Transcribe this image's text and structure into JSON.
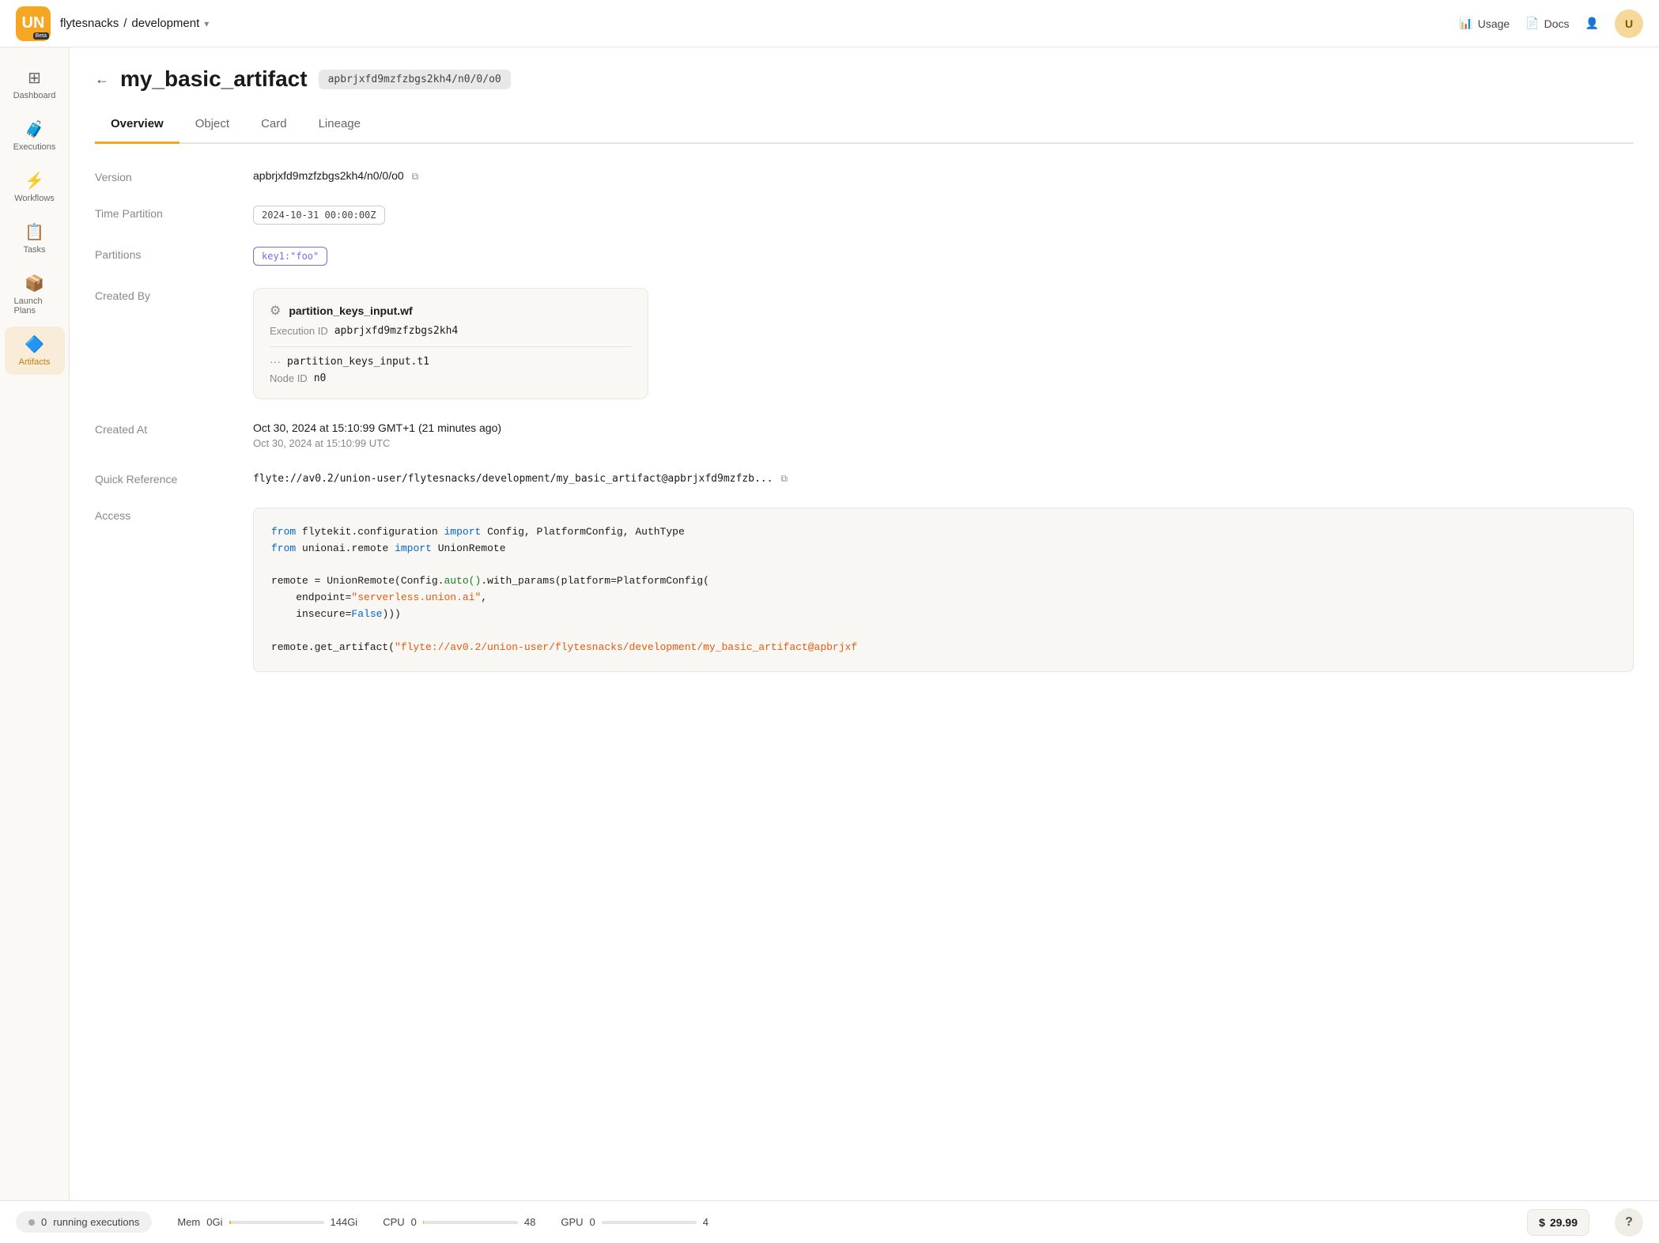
{
  "topnav": {
    "logo_text": "UN",
    "logo_beta": "Beta",
    "project": "flytesnacks",
    "env": "development",
    "usage_label": "Usage",
    "docs_label": "Docs",
    "user_initial": "U"
  },
  "sidebar": {
    "items": [
      {
        "id": "dashboard",
        "label": "Dashboard",
        "icon": "⊞"
      },
      {
        "id": "executions",
        "label": "Executions",
        "icon": "🧳"
      },
      {
        "id": "workflows",
        "label": "Workflows",
        "icon": "⚡"
      },
      {
        "id": "tasks",
        "label": "Tasks",
        "icon": "📋"
      },
      {
        "id": "launch-plans",
        "label": "Launch Plans",
        "icon": "📦"
      },
      {
        "id": "artifacts",
        "label": "Artifacts",
        "icon": "🔷",
        "active": true
      }
    ]
  },
  "page": {
    "back_arrow": "←",
    "title": "my_basic_artifact",
    "version_badge": "apbrjxfd9mzfzbgs2kh4/n0/0/o0"
  },
  "tabs": [
    {
      "id": "overview",
      "label": "Overview",
      "active": true
    },
    {
      "id": "object",
      "label": "Object"
    },
    {
      "id": "card",
      "label": "Card"
    },
    {
      "id": "lineage",
      "label": "Lineage"
    }
  ],
  "overview": {
    "version": {
      "label": "Version",
      "value": "apbrjxfd9mzfzbgs2kh4/n0/0/o0"
    },
    "time_partition": {
      "label": "Time Partition",
      "value": "2024-10-31 00:00:00Z"
    },
    "partitions": {
      "label": "Partitions",
      "value": "key1:\"foo\""
    },
    "created_by": {
      "label": "Created By",
      "workflow_name": "partition_keys_input.wf",
      "execution_id_label": "Execution ID",
      "execution_id": "apbrjxfd9mzfzbgs2kh4",
      "node_name": "partition_keys_input.t1",
      "node_id_label": "Node ID",
      "node_id": "n0"
    },
    "created_at": {
      "label": "Created At",
      "primary": "Oct 30, 2024 at 15:10:99 GMT+1 (21 minutes ago)",
      "secondary": "Oct 30, 2024 at 15:10:99 UTC"
    },
    "quick_reference": {
      "label": "Quick Reference",
      "value": "flyte://av0.2/union-user/flytesnacks/development/my_basic_artifact@apbrjxfd9mzfzb..."
    },
    "access": {
      "label": "Access",
      "code": {
        "line1_from": "from",
        "line1_pkg1": "flytekit.configuration",
        "line1_import": "import",
        "line1_items": "Config, PlatformConfig, AuthType",
        "line2_from": "from",
        "line2_pkg2": "unionai.remote",
        "line2_import": "import",
        "line2_item": "UnionRemote",
        "line3": "",
        "line4_pre": "remote = UnionRemote(Config.",
        "line4_method": "auto()",
        "line4_post": ".with_params(platform=PlatformConfig(",
        "line5_pre": "    endpoint=",
        "line5_val": "\"serverless.union.ai\"",
        "line5_post": ",",
        "line6_pre": "    insecure=",
        "line6_val": "False",
        "line6_post": ")))",
        "line7": "",
        "line8": "remote.get_artifact(\"flyte://av0.2/union-user/flytesnacks/development/my_basic_artifact@apbrjxf"
      }
    }
  },
  "status_bar": {
    "running_count": "0",
    "running_label": "running executions",
    "mem_label": "Mem",
    "mem_used": "0Gi",
    "mem_total": "144Gi",
    "mem_pct": 2,
    "cpu_label": "CPU",
    "cpu_used": "0",
    "cpu_total": "48",
    "cpu_pct": 1,
    "gpu_label": "GPU",
    "gpu_used": "0",
    "gpu_total": "4",
    "gpu_pct": 0,
    "cost": "$ 29.99",
    "help": "?"
  }
}
